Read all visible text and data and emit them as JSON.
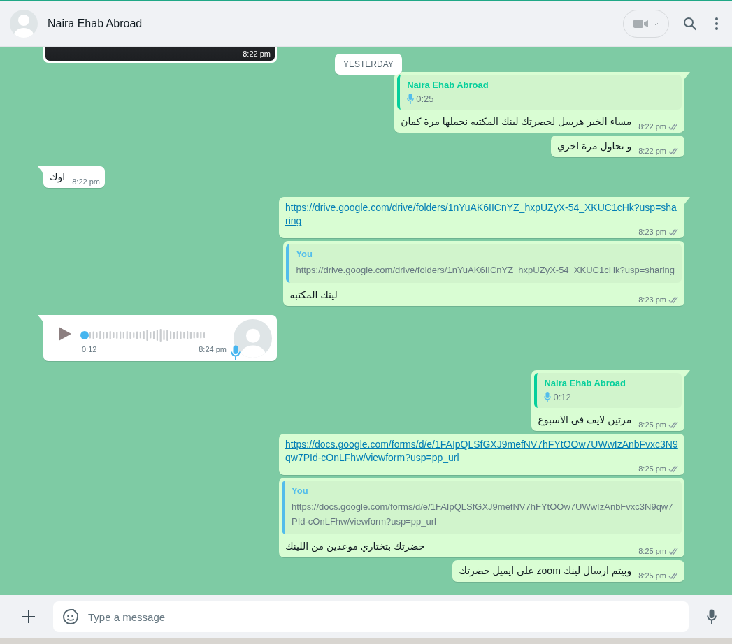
{
  "header": {
    "contact_name": "Naira Ehab Abroad"
  },
  "date_chip": "YESTERDAY",
  "messages": [
    {
      "kind": "image",
      "outgoing": false,
      "time": "8:22 pm"
    },
    {
      "kind": "reply",
      "outgoing": true,
      "quote": {
        "kind": "voice",
        "author": "Naira Ehab Abroad",
        "color": "#06cf9c",
        "duration": "0:25"
      },
      "text": "مساء الخير هرسل لحضرتك لينك المكتبه نحملها مرة كمان",
      "time": "8:22 pm",
      "delivered": true
    },
    {
      "kind": "text",
      "outgoing": true,
      "text": "و نحاول مرة اخري",
      "time": "8:22 pm",
      "delivered": true
    },
    {
      "kind": "text",
      "outgoing": false,
      "text": "اوك",
      "time": "8:22 pm"
    },
    {
      "kind": "link",
      "outgoing": true,
      "text": "https://drive.google.com/drive/folders/1nYuAK6IICnYZ_hxpUZyX-54_XKUC1cHk?usp=sharing",
      "time": "8:23 pm",
      "delivered": true
    },
    {
      "kind": "reply",
      "outgoing": true,
      "quote": {
        "kind": "text",
        "author": "You",
        "color": "#53bdeb",
        "text": "https://drive.google.com/drive/folders/1nYuAK6IICnYZ_hxpUZyX-54_XKUC1cHk?usp=sharing"
      },
      "text": "لينك المكتبه",
      "time": "8:23 pm",
      "delivered": true
    },
    {
      "kind": "voice",
      "outgoing": false,
      "duration": "0:12",
      "time": "8:24 pm"
    },
    {
      "kind": "reply",
      "outgoing": true,
      "quote": {
        "kind": "voice",
        "author": "Naira Ehab Abroad",
        "color": "#06cf9c",
        "duration": "0:12"
      },
      "text": "مرتين لايف في الاسبوع",
      "time": "8:25 pm",
      "delivered": true
    },
    {
      "kind": "link",
      "outgoing": true,
      "text": "https://docs.google.com/forms/d/e/1FAIpQLSfGXJ9mefNV7hFYtOOw7UWwIzAnbFvxc3N9qw7PId-cOnLFhw/viewform?usp=pp_url",
      "time": "8:25 pm",
      "delivered": true
    },
    {
      "kind": "reply",
      "outgoing": true,
      "quote": {
        "kind": "text",
        "author": "You",
        "color": "#53bdeb",
        "text": "https://docs.google.com/forms/d/e/1FAIpQLSfGXJ9mefNV7hFYtOOw7UWwIzAnbFvxc3N9qw7PId-cOnLFhw/viewform?usp=pp_url"
      },
      "text": "حضرتك بتختاري موعدين من اللينك",
      "time": "8:25 pm",
      "delivered": true
    },
    {
      "kind": "text",
      "outgoing": true,
      "text": "وبيتم ارسال لينك zoom علي ايميل حضرتك",
      "time": "8:25 pm",
      "delivered": true
    }
  ],
  "composer": {
    "placeholder": "Type a message"
  }
}
